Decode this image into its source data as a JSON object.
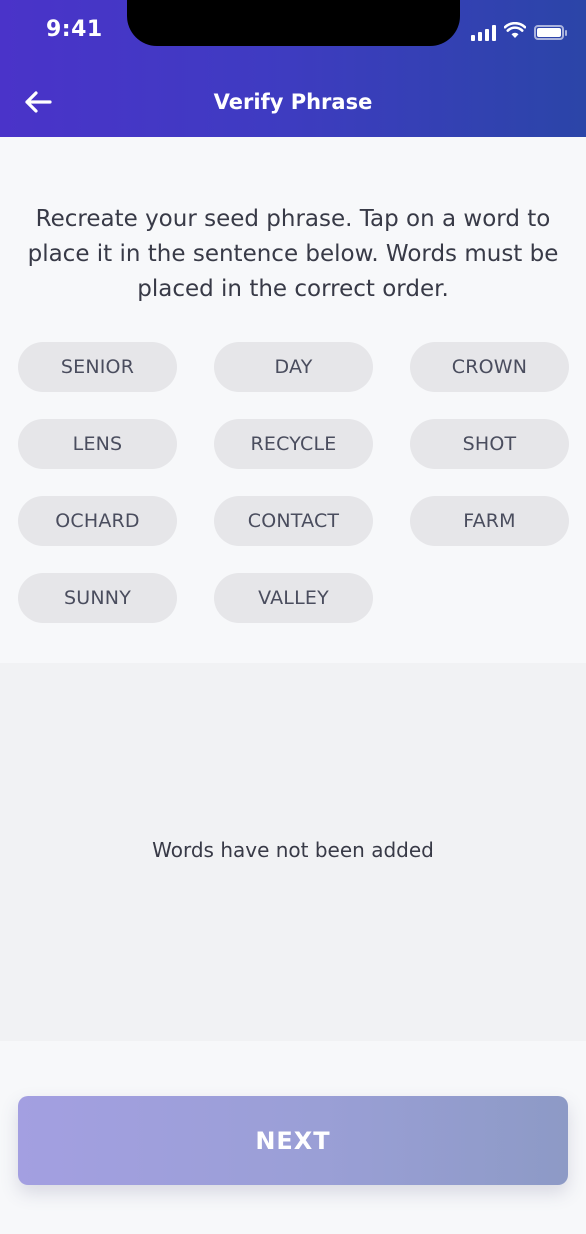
{
  "status_bar": {
    "time": "9:41",
    "icons": [
      "cellular-signal-icon",
      "wifi-icon",
      "battery-icon"
    ]
  },
  "header": {
    "back_icon": "back-arrow-icon",
    "title": "Verify Phrase"
  },
  "instructions": "Recreate your seed phrase. Tap on a word to place it in the sentence below. Words must be placed in the correct order.",
  "words": [
    "SENIOR",
    "DAY",
    "CROWN",
    "LENS",
    "RECYCLE",
    "SHOT",
    "OCHARD",
    "CONTACT",
    "FARM",
    "SUNNY",
    "VALLEY"
  ],
  "selected": {
    "empty_text": "Words have not been added"
  },
  "footer": {
    "next_label": "NEXT"
  },
  "colors": {
    "header_start": "#4a33c9",
    "header_end": "#2b45a8",
    "chip_bg": "#e6e6e9",
    "button_start": "#a39fe1",
    "button_end": "#8d9ac6"
  }
}
